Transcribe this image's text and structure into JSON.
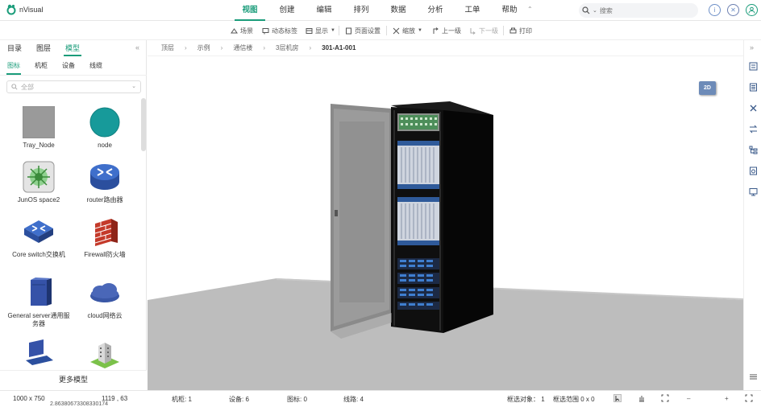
{
  "app": {
    "name": "nVisual"
  },
  "menu": [
    {
      "label": "视图",
      "active": true
    },
    {
      "label": "创建"
    },
    {
      "label": "编辑"
    },
    {
      "label": "排列"
    },
    {
      "label": "数据"
    },
    {
      "label": "分析"
    },
    {
      "label": "工单"
    },
    {
      "label": "帮助"
    }
  ],
  "search": {
    "placeholder": "搜索"
  },
  "toolbar": {
    "scene": "场景",
    "dynamic_label": "动态标签",
    "display": "显示",
    "page_setup": "页面设置",
    "zoom": "缩放",
    "level_up": "上一级",
    "level_down": "下一级",
    "print": "打印"
  },
  "left_panel": {
    "tabs": [
      "目录",
      "图层",
      "模型"
    ],
    "active_tab": "模型",
    "subtabs": [
      "图标",
      "机柜",
      "设备",
      "线缆"
    ],
    "active_subtab": "图标",
    "filter_value": "全部",
    "models": [
      {
        "label": "Tray_Node",
        "icon": "gray-square-icon"
      },
      {
        "label": "node",
        "icon": "teal-circle-icon"
      },
      {
        "label": "JunOS space2",
        "icon": "junos-icon"
      },
      {
        "label": "router路由器",
        "icon": "router-icon"
      },
      {
        "label": "Core switch交换机",
        "icon": "switch-icon"
      },
      {
        "label": "Firewall防火墙",
        "icon": "firewall-icon"
      },
      {
        "label": "General server通用服务器",
        "icon": "server-icon"
      },
      {
        "label": "cloud网络云",
        "icon": "cloud-icon"
      },
      {
        "label": "",
        "icon": "workstation-icon"
      },
      {
        "label": "",
        "icon": "building-icon"
      }
    ],
    "more_models": "更多模型"
  },
  "breadcrumb": [
    "顶层",
    "示例",
    "通信楼",
    "3层机房",
    "301-A1-001"
  ],
  "viewport": {
    "mode_button": "2D"
  },
  "status": {
    "canvas_size": "1000 x 750",
    "cursor": "1119 , 63",
    "cursor_extra": "2.86380673308330174",
    "cabinets": "机柜: 1",
    "devices": "设备: 6",
    "icons": "图标: 0",
    "lines": "线路: 4",
    "selected": "框选对象： 1",
    "selection_range": "框选范围  0 x 0",
    "zoom_minus": "–",
    "zoom_plus": "+"
  },
  "colors": {
    "accent": "#1a9c7a",
    "button_2d": "#6d8bb8"
  }
}
